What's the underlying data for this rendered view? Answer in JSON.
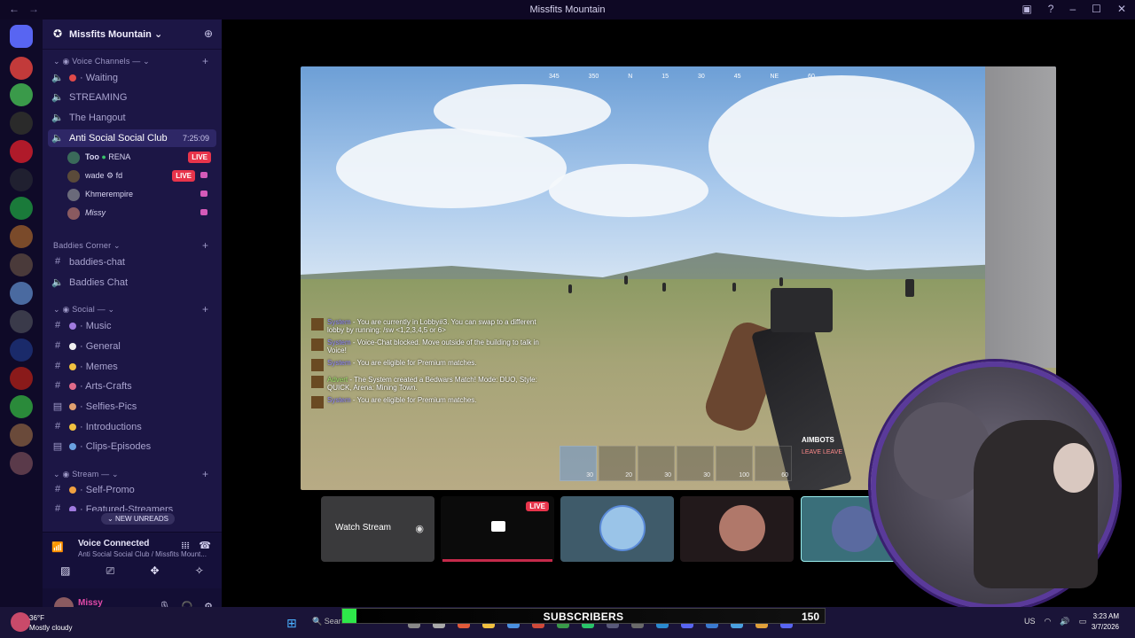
{
  "window": {
    "title": "Missfits Mountain"
  },
  "server": {
    "name": "Missfits Mountain"
  },
  "voice_channels_category": "Voice Channels —",
  "voice_channels": [
    {
      "label": "Waiting"
    },
    {
      "label": "STREAMING"
    },
    {
      "label": "The Hangout"
    },
    {
      "label": "Anti Social Social Club",
      "timer": "7:25:09"
    }
  ],
  "voice_users": [
    {
      "name": "Too",
      "tag": "RENA",
      "live": "LIVE"
    },
    {
      "name": "wade",
      "tag": "fd",
      "live": "LIVE"
    },
    {
      "name": "Khmerempire"
    },
    {
      "name": "Missy"
    }
  ],
  "baddies_category": "Baddies Corner",
  "baddies_channels": [
    {
      "label": "baddies-chat"
    },
    {
      "label": "Baddies Chat"
    }
  ],
  "social_category": "Social —",
  "social_channels": [
    {
      "label": "Music"
    },
    {
      "label": "General"
    },
    {
      "label": "Memes"
    },
    {
      "label": "Arts-Crafts"
    },
    {
      "label": "Selfies-Pics"
    },
    {
      "label": "Introductions"
    },
    {
      "label": "Clips-Episodes"
    }
  ],
  "stream_category": "Stream —",
  "stream_channels": [
    {
      "label": "Self-Promo"
    },
    {
      "label": "Featured-Streamers"
    }
  ],
  "new_unreads": "NEW UNREADS",
  "voice_connected": {
    "status": "Voice Connected",
    "location": "Anti Social Social Club / Missfits Mount..."
  },
  "user_panel": {
    "name": "Missy",
    "status": "chilling"
  },
  "game": {
    "compass": [
      "345",
      "350",
      "N",
      "15",
      "30",
      "45",
      "NE",
      "60"
    ],
    "chat": [
      {
        "who": "System",
        "text": "- You are currently in Lobby#3. You can swap to a different lobby by running: /sw <1,2,3,4,5 or 6>"
      },
      {
        "who": "System",
        "text": "- Voice-Chat blocked. Move outside of the building to talk in Voice!"
      },
      {
        "who": "System",
        "text": "- You are eligible for Premium matches."
      },
      {
        "who": "Advert",
        "text": "- The System created a Bedwars Match! Mode: DUO, Style: QUICK, Arena: Mining Town."
      },
      {
        "who": "System",
        "text": "- You are eligible for Premium matches."
      }
    ],
    "hotbar": [
      "30",
      "20",
      "30",
      "30",
      "100",
      "60"
    ],
    "aimbots": "AIMBOTS",
    "leave": "LEAVE LEAVE"
  },
  "tiles": {
    "watch_stream": "Watch Stream",
    "live": "LIVE"
  },
  "subscribers": {
    "label": "SUBSCRIBERS",
    "count": "150",
    "progress": 0.03
  },
  "taskbar": {
    "temp": "36°F",
    "weather": "Mostly cloudy",
    "search": "Search",
    "lang": "US",
    "time": "3:23 AM",
    "date": "3/7/2026"
  }
}
